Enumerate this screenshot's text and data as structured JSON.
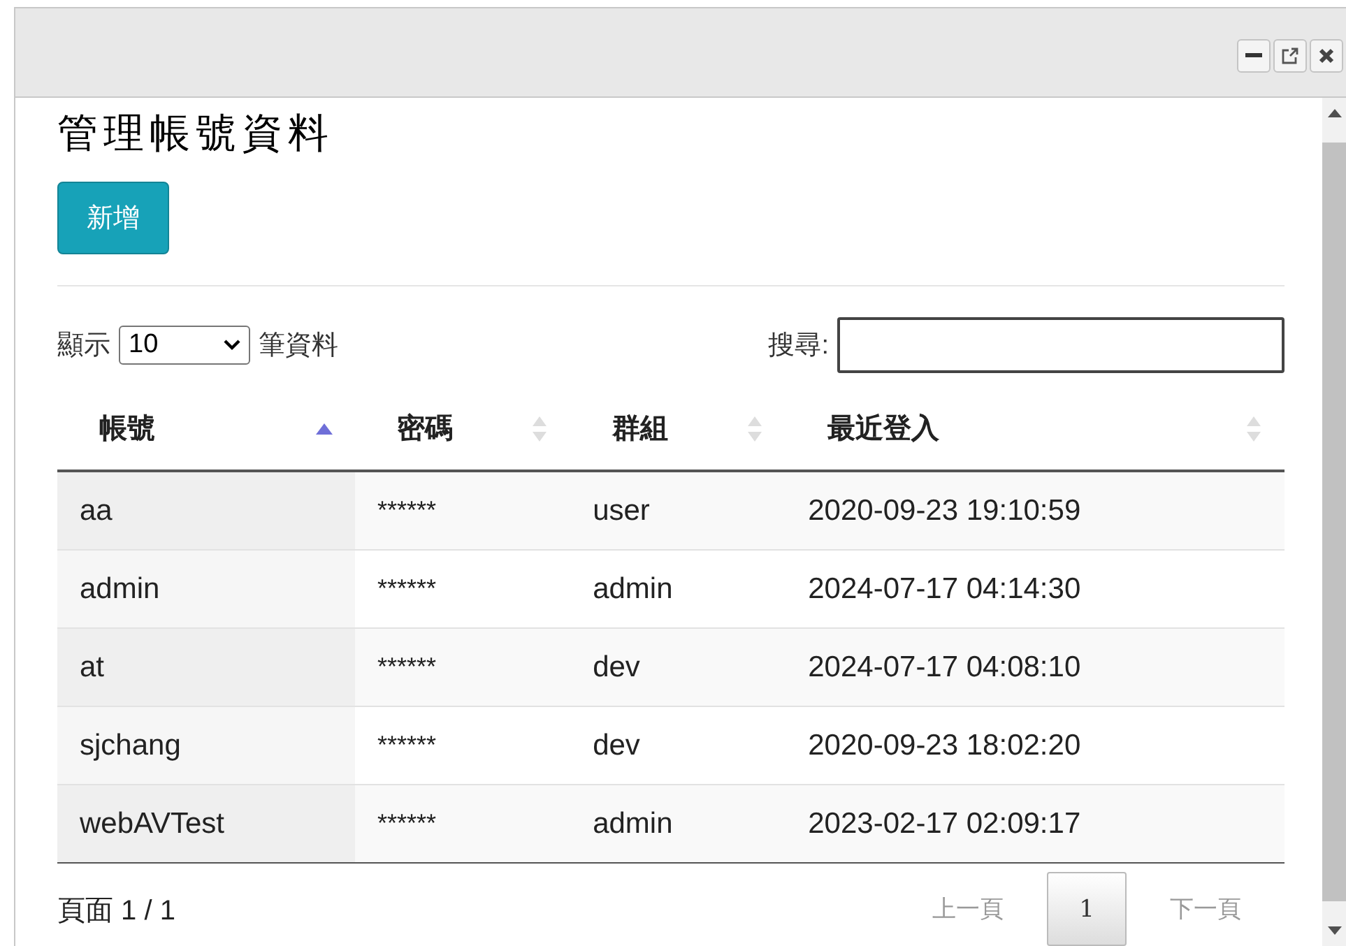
{
  "window": {
    "controls": [
      {
        "kind": "minimize"
      },
      {
        "kind": "popout"
      },
      {
        "kind": "close"
      }
    ]
  },
  "title": "管理帳號資料",
  "add_button": "新增",
  "length": {
    "prefix": "顯示",
    "value": "10",
    "suffix": "筆資料"
  },
  "search": {
    "label": "搜尋:"
  },
  "table": {
    "columns": [
      {
        "label": "帳號",
        "sorted": true
      },
      {
        "label": "密碼",
        "sorted": false
      },
      {
        "label": "群組",
        "sorted": false
      },
      {
        "label": "最近登入",
        "sorted": false
      }
    ],
    "rows": [
      [
        "aa",
        "******",
        "user",
        "2020-09-23 19:10:59"
      ],
      [
        "admin",
        "******",
        "admin",
        "2024-07-17 04:14:30"
      ],
      [
        "at",
        "******",
        "dev",
        "2024-07-17 04:08:10"
      ],
      [
        "sjchang",
        "******",
        "dev",
        "2020-09-23 18:02:20"
      ],
      [
        "webAVTest",
        "******",
        "admin",
        "2023-02-17 02:09:17"
      ]
    ]
  },
  "info": "頁面 1 / 1",
  "pagination": [
    {
      "label": "上一頁",
      "disabled": true,
      "selected": false
    },
    {
      "label": "1",
      "disabled": false,
      "selected": true
    },
    {
      "label": "下一頁",
      "disabled": true,
      "selected": false
    }
  ]
}
